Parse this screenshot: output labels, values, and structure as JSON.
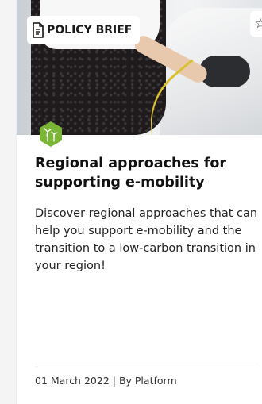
{
  "card": {
    "category_label": "POLICY BRIEF",
    "title": "Regional approaches for supporting e-mobility",
    "description": "Discover regional approaches that can help you support e-mobility and the transition to a low-carbon transition in your region!",
    "date": "01 March 2022",
    "separator": " | ",
    "author": "By Platform",
    "image_subject": "person plugging a charging cable into an electric car",
    "topic_icon": "wind-energy-icon",
    "bookmark_icon": "star-outline-icon",
    "category_icon": "document-icon",
    "colors": {
      "topic_icon_bg": "#7bb535",
      "badge_bg": "#ffffff",
      "cable": "#d8c12c"
    }
  }
}
